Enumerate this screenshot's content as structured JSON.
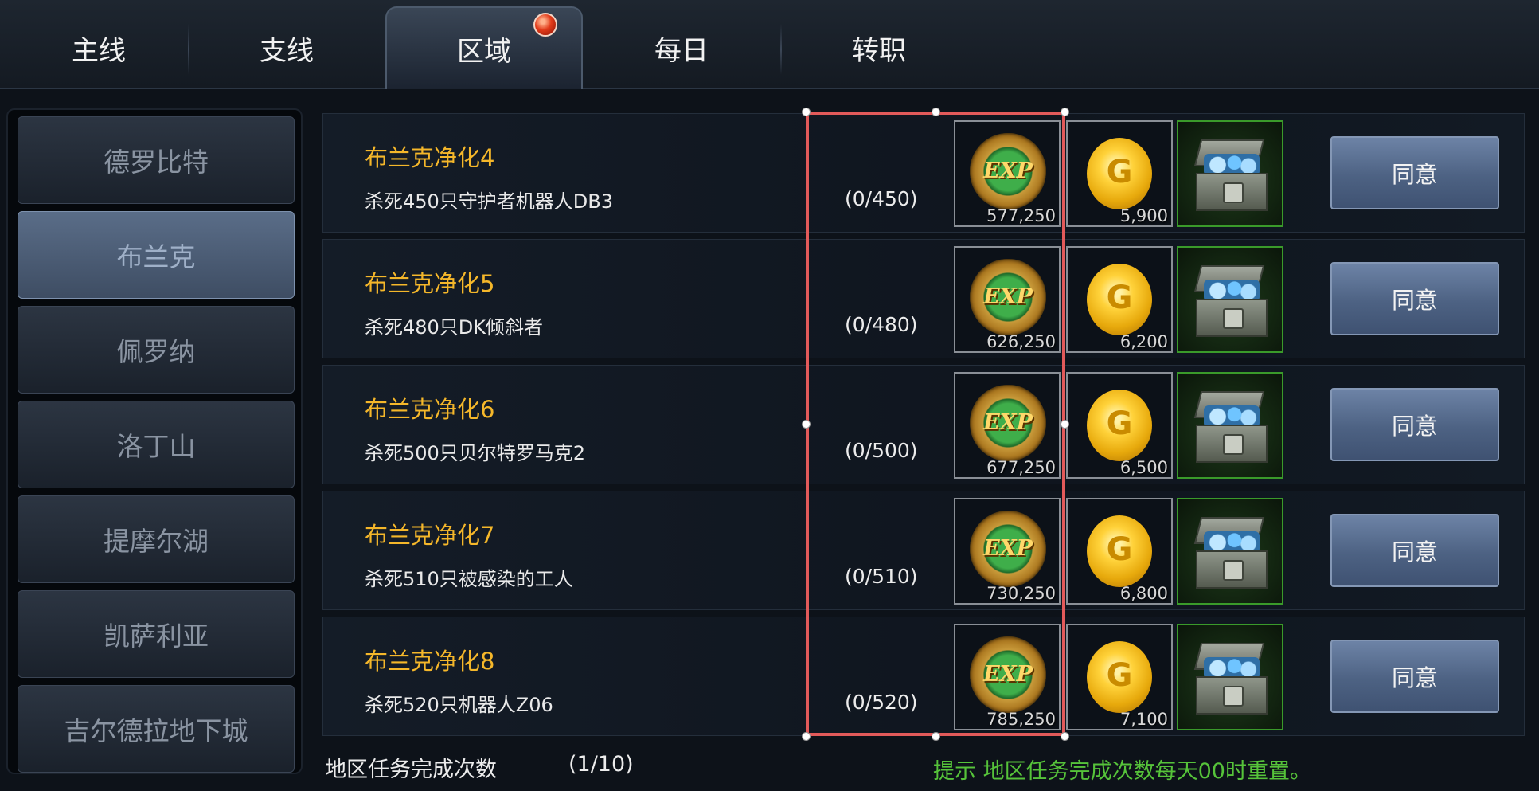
{
  "tabs": [
    {
      "label": "主线"
    },
    {
      "label": "支线"
    },
    {
      "label": "区域"
    },
    {
      "label": "每日"
    },
    {
      "label": "转职"
    }
  ],
  "active_tab": "区域",
  "regions": [
    {
      "label": "德罗比特"
    },
    {
      "label": "布兰克"
    },
    {
      "label": "佩罗纳"
    },
    {
      "label": "洛丁山"
    },
    {
      "label": "提摩尔湖"
    },
    {
      "label": "凯萨利亚"
    },
    {
      "label": "吉尔德拉地下城"
    }
  ],
  "active_region": "布兰克",
  "quests": [
    {
      "title": "布兰克净化4",
      "desc": "杀死450只守护者机器人DB3",
      "progress": "(0/450)",
      "exp": "577,250",
      "gold": "5,900",
      "exp_label": "EXP",
      "gold_label": "G",
      "button": "同意"
    },
    {
      "title": "布兰克净化5",
      "desc": "杀死480只DK倾斜者",
      "progress": "(0/480)",
      "exp": "626,250",
      "gold": "6,200",
      "exp_label": "EXP",
      "gold_label": "G",
      "button": "同意"
    },
    {
      "title": "布兰克净化6",
      "desc": "杀死500只贝尔特罗马克2",
      "progress": "(0/500)",
      "exp": "677,250",
      "gold": "6,500",
      "exp_label": "EXP",
      "gold_label": "G",
      "button": "同意"
    },
    {
      "title": "布兰克净化7",
      "desc": "杀死510只被感染的工人",
      "progress": "(0/510)",
      "exp": "730,250",
      "gold": "6,800",
      "exp_label": "EXP",
      "gold_label": "G",
      "button": "同意"
    },
    {
      "title": "布兰克净化8",
      "desc": "杀死520只机器人Z06",
      "progress": "(0/520)",
      "exp": "785,250",
      "gold": "7,100",
      "exp_label": "EXP",
      "gold_label": "G",
      "button": "同意"
    }
  ],
  "footer": {
    "label": "地区任务完成次数",
    "count": "(1/10)",
    "hint": "提示 地区任务完成次数每天00时重置。"
  },
  "colors": {
    "quest_title": "#f5b72a",
    "hint": "#56c33a",
    "selection_box": "#e25a5a"
  }
}
